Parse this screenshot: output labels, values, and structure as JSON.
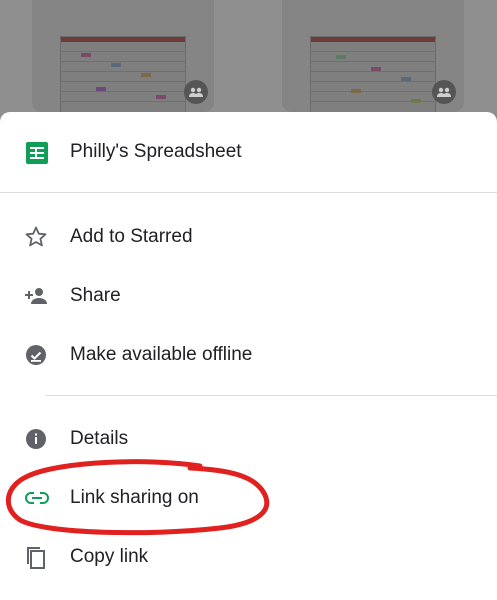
{
  "file": {
    "name": "Philly's Spreadsheet",
    "icon": "google-sheets-icon",
    "icon_color": "#0F9D58"
  },
  "menu": {
    "items": [
      {
        "label": "Add to Starred",
        "icon": "star-outline-icon"
      },
      {
        "label": "Share",
        "icon": "person-add-icon"
      },
      {
        "label": "Make available offline",
        "icon": "offline-check-icon"
      },
      {
        "label": "Details",
        "icon": "info-icon"
      },
      {
        "label": "Link sharing on",
        "icon": "link-icon",
        "icon_color": "#0F9D58"
      },
      {
        "label": "Copy link",
        "icon": "copy-icon"
      }
    ]
  },
  "annotation": {
    "color": "#e0211f",
    "shape": "hand-drawn circle around Link sharing on"
  },
  "colors": {
    "overlay": "#9e9e9e",
    "text": "#202124",
    "icon": "#5f6368",
    "divider": "#dadce0"
  }
}
